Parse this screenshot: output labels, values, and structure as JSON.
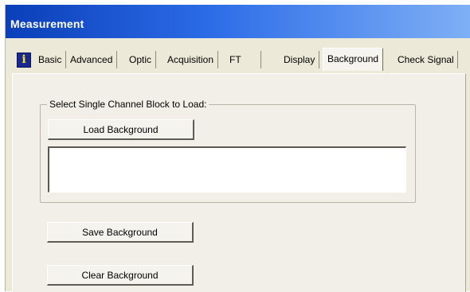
{
  "window": {
    "title": "Measurement"
  },
  "tabs": [
    {
      "label": "Basic"
    },
    {
      "label": "Advanced"
    },
    {
      "label": "Optic"
    },
    {
      "label": "Acquisition"
    },
    {
      "label": "FT"
    },
    {
      "label": "Display"
    },
    {
      "label": "Background",
      "selected": true
    },
    {
      "label": "Check Signal"
    }
  ],
  "info_icon": {
    "glyph": "i",
    "icon": "info-icon"
  },
  "group": {
    "title": "Select Single Channel Block to Load:",
    "load_button": "Load Background",
    "list_items": []
  },
  "buttons": {
    "save": "Save Background",
    "clear": "Clear Background"
  }
}
